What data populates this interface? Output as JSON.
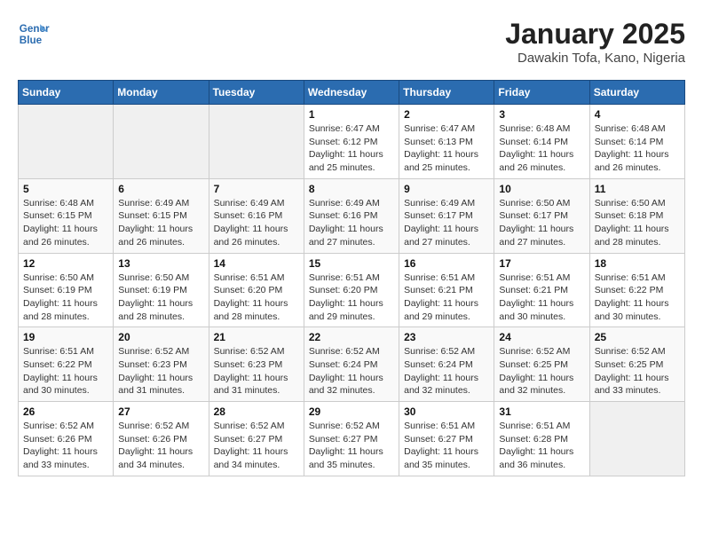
{
  "header": {
    "logo_line1": "General",
    "logo_line2": "Blue",
    "main_title": "January 2025",
    "subtitle": "Dawakin Tofa, Kano, Nigeria"
  },
  "weekdays": [
    "Sunday",
    "Monday",
    "Tuesday",
    "Wednesday",
    "Thursday",
    "Friday",
    "Saturday"
  ],
  "weeks": [
    [
      {
        "day": "",
        "info": ""
      },
      {
        "day": "",
        "info": ""
      },
      {
        "day": "",
        "info": ""
      },
      {
        "day": "1",
        "info": "Sunrise: 6:47 AM\nSunset: 6:12 PM\nDaylight: 11 hours and 25 minutes."
      },
      {
        "day": "2",
        "info": "Sunrise: 6:47 AM\nSunset: 6:13 PM\nDaylight: 11 hours and 25 minutes."
      },
      {
        "day": "3",
        "info": "Sunrise: 6:48 AM\nSunset: 6:14 PM\nDaylight: 11 hours and 26 minutes."
      },
      {
        "day": "4",
        "info": "Sunrise: 6:48 AM\nSunset: 6:14 PM\nDaylight: 11 hours and 26 minutes."
      }
    ],
    [
      {
        "day": "5",
        "info": "Sunrise: 6:48 AM\nSunset: 6:15 PM\nDaylight: 11 hours and 26 minutes."
      },
      {
        "day": "6",
        "info": "Sunrise: 6:49 AM\nSunset: 6:15 PM\nDaylight: 11 hours and 26 minutes."
      },
      {
        "day": "7",
        "info": "Sunrise: 6:49 AM\nSunset: 6:16 PM\nDaylight: 11 hours and 26 minutes."
      },
      {
        "day": "8",
        "info": "Sunrise: 6:49 AM\nSunset: 6:16 PM\nDaylight: 11 hours and 27 minutes."
      },
      {
        "day": "9",
        "info": "Sunrise: 6:49 AM\nSunset: 6:17 PM\nDaylight: 11 hours and 27 minutes."
      },
      {
        "day": "10",
        "info": "Sunrise: 6:50 AM\nSunset: 6:17 PM\nDaylight: 11 hours and 27 minutes."
      },
      {
        "day": "11",
        "info": "Sunrise: 6:50 AM\nSunset: 6:18 PM\nDaylight: 11 hours and 28 minutes."
      }
    ],
    [
      {
        "day": "12",
        "info": "Sunrise: 6:50 AM\nSunset: 6:19 PM\nDaylight: 11 hours and 28 minutes."
      },
      {
        "day": "13",
        "info": "Sunrise: 6:50 AM\nSunset: 6:19 PM\nDaylight: 11 hours and 28 minutes."
      },
      {
        "day": "14",
        "info": "Sunrise: 6:51 AM\nSunset: 6:20 PM\nDaylight: 11 hours and 28 minutes."
      },
      {
        "day": "15",
        "info": "Sunrise: 6:51 AM\nSunset: 6:20 PM\nDaylight: 11 hours and 29 minutes."
      },
      {
        "day": "16",
        "info": "Sunrise: 6:51 AM\nSunset: 6:21 PM\nDaylight: 11 hours and 29 minutes."
      },
      {
        "day": "17",
        "info": "Sunrise: 6:51 AM\nSunset: 6:21 PM\nDaylight: 11 hours and 30 minutes."
      },
      {
        "day": "18",
        "info": "Sunrise: 6:51 AM\nSunset: 6:22 PM\nDaylight: 11 hours and 30 minutes."
      }
    ],
    [
      {
        "day": "19",
        "info": "Sunrise: 6:51 AM\nSunset: 6:22 PM\nDaylight: 11 hours and 30 minutes."
      },
      {
        "day": "20",
        "info": "Sunrise: 6:52 AM\nSunset: 6:23 PM\nDaylight: 11 hours and 31 minutes."
      },
      {
        "day": "21",
        "info": "Sunrise: 6:52 AM\nSunset: 6:23 PM\nDaylight: 11 hours and 31 minutes."
      },
      {
        "day": "22",
        "info": "Sunrise: 6:52 AM\nSunset: 6:24 PM\nDaylight: 11 hours and 32 minutes."
      },
      {
        "day": "23",
        "info": "Sunrise: 6:52 AM\nSunset: 6:24 PM\nDaylight: 11 hours and 32 minutes."
      },
      {
        "day": "24",
        "info": "Sunrise: 6:52 AM\nSunset: 6:25 PM\nDaylight: 11 hours and 32 minutes."
      },
      {
        "day": "25",
        "info": "Sunrise: 6:52 AM\nSunset: 6:25 PM\nDaylight: 11 hours and 33 minutes."
      }
    ],
    [
      {
        "day": "26",
        "info": "Sunrise: 6:52 AM\nSunset: 6:26 PM\nDaylight: 11 hours and 33 minutes."
      },
      {
        "day": "27",
        "info": "Sunrise: 6:52 AM\nSunset: 6:26 PM\nDaylight: 11 hours and 34 minutes."
      },
      {
        "day": "28",
        "info": "Sunrise: 6:52 AM\nSunset: 6:27 PM\nDaylight: 11 hours and 34 minutes."
      },
      {
        "day": "29",
        "info": "Sunrise: 6:52 AM\nSunset: 6:27 PM\nDaylight: 11 hours and 35 minutes."
      },
      {
        "day": "30",
        "info": "Sunrise: 6:51 AM\nSunset: 6:27 PM\nDaylight: 11 hours and 35 minutes."
      },
      {
        "day": "31",
        "info": "Sunrise: 6:51 AM\nSunset: 6:28 PM\nDaylight: 11 hours and 36 minutes."
      },
      {
        "day": "",
        "info": ""
      }
    ]
  ]
}
